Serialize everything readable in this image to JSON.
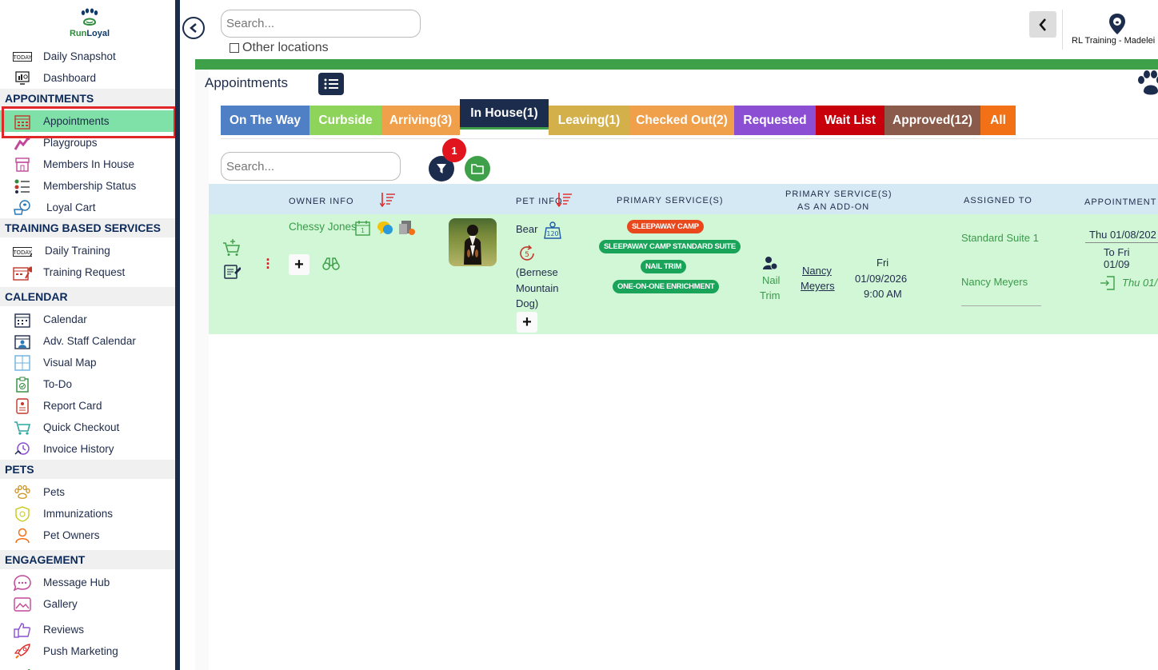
{
  "brand": {
    "name_part1": "Run",
    "name_part2": "Loyal"
  },
  "sidebar": {
    "items_top": [
      {
        "label": "Daily Snapshot",
        "icon": "today-calendar-icon"
      },
      {
        "label": "Dashboard",
        "icon": "dashboard-monitor-icon"
      }
    ],
    "sections": [
      {
        "title": "APPOINTMENTS",
        "items": [
          {
            "label": "Appointments",
            "icon": "calendar-grid-icon",
            "active": true
          },
          {
            "label": "Playgroups",
            "icon": "dog-play-icon"
          },
          {
            "label": "Members In House",
            "icon": "house-store-icon"
          },
          {
            "label": "Membership Status",
            "icon": "member-list-icon"
          },
          {
            "label": "Loyal Cart",
            "icon": "loyal-cart-icon"
          }
        ]
      },
      {
        "title": "TRAINING BASED SERVICES",
        "items": [
          {
            "label": "Daily Training",
            "icon": "today-training-icon"
          },
          {
            "label": "Training Request",
            "icon": "training-request-icon"
          }
        ]
      },
      {
        "title": "CALENDAR",
        "items": [
          {
            "label": "Calendar",
            "icon": "calendar-icon"
          },
          {
            "label": "Adv. Staff Calendar",
            "icon": "staff-calendar-icon"
          },
          {
            "label": "Visual Map",
            "icon": "map-grid-icon"
          },
          {
            "label": "To-Do",
            "icon": "todo-clipboard-icon"
          },
          {
            "label": "Report Card",
            "icon": "report-card-icon"
          },
          {
            "label": "Quick Checkout",
            "icon": "cart-icon"
          },
          {
            "label": "Invoice History",
            "icon": "history-icon"
          }
        ]
      },
      {
        "title": "PETS",
        "items": [
          {
            "label": "Pets",
            "icon": "paw-icon"
          },
          {
            "label": "Immunizations",
            "icon": "immunization-badge-icon"
          },
          {
            "label": "Pet Owners",
            "icon": "person-icon"
          }
        ]
      },
      {
        "title": "ENGAGEMENT",
        "items": [
          {
            "label": "Message Hub",
            "icon": "chat-bubble-icon"
          },
          {
            "label": "Gallery",
            "icon": "image-icon"
          },
          {
            "label": "Reviews",
            "icon": "thumbs-up-icon"
          },
          {
            "label": "Push Marketing",
            "icon": "rocket-icon"
          }
        ]
      }
    ]
  },
  "header": {
    "search_placeholder": "Search...",
    "other_locations_label": "Other locations",
    "location_name": "RL Training - Madelei"
  },
  "page": {
    "title": "Appointments",
    "tabs": [
      {
        "label": "On The Way",
        "color": "#4f7fc5"
      },
      {
        "label": "Curbside",
        "color": "#8fd45a"
      },
      {
        "label": "Arriving(3)",
        "color": "#f0a04b"
      },
      {
        "label": "In House(1)",
        "color": "#1c2c4c",
        "selected": true
      },
      {
        "label": "Leaving(1)",
        "color": "#d4b04a"
      },
      {
        "label": "Checked Out(2)",
        "color": "#f0a04b"
      },
      {
        "label": "Requested",
        "color": "#8c4fd4"
      },
      {
        "label": "Wait List",
        "color": "#c8000c"
      },
      {
        "label": "Approved(12)",
        "color": "#8a5a4a"
      },
      {
        "label": "All",
        "color": "#f27016"
      }
    ],
    "list_search_placeholder": "Search...",
    "filter_count": "1"
  },
  "table": {
    "headers": {
      "owner_info": "OWNER INFO",
      "pet_info": "PET INFO",
      "primary_services": "PRIMARY SERVICE(S)",
      "primary_addon_line1": "PRIMARY SERVICE(S)",
      "primary_addon_line2": "AS AN ADD-ON",
      "assigned_to": "ASSIGNED TO",
      "appointment": "APPOINTMENT C"
    },
    "row": {
      "owner_name": "Chessy Jones",
      "pet_name": "Bear",
      "pet_weight": "120",
      "pet_visits": "5",
      "pet_breed_line1": "(Bernese",
      "pet_breed_line2": "Mountain",
      "pet_breed_line3": "Dog)",
      "services": [
        {
          "label": "SLEEPAWAY CAMP",
          "color": "#e8481c"
        },
        {
          "label": "SLEEPAWAY CAMP STANDARD SUITE",
          "color": "#1aa45a"
        },
        {
          "label": "NAIL TRIM",
          "color": "#1aa45a"
        },
        {
          "label": "ONE-ON-ONE ENRICHMENT",
          "color": "#1aa45a"
        }
      ],
      "addon_service_line1": "Nail",
      "addon_service_line2": "Trim",
      "addon_staff_line1": "Nancy",
      "addon_staff_line2": "Meyers",
      "addon_day": "Fri",
      "addon_date": "01/09/2026",
      "addon_time": "9:00 AM",
      "assigned_suite": "Standard Suite 1",
      "assigned_staff": "Nancy Meyers",
      "appt_start": "Thu 01/08/202",
      "appt_end": "To Fri 01/09",
      "appt_checkin": "Thu 01/"
    }
  }
}
